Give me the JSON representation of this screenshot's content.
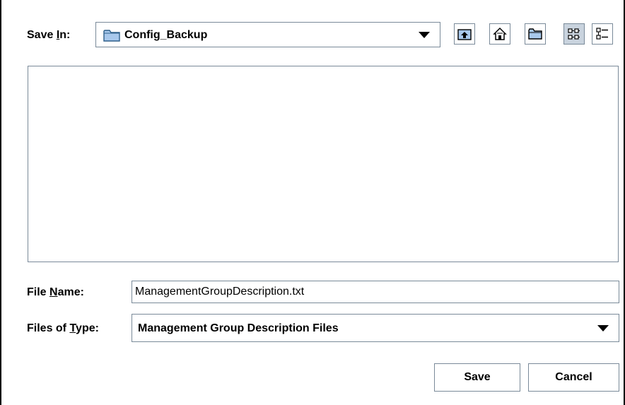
{
  "save_in": {
    "label_pre": "Save ",
    "label_mnemonic": "I",
    "label_post": "n:",
    "folder": "Config_Backup",
    "folder_icon": "folder-icon"
  },
  "toolbar": {
    "up_icon": "up-folder-icon",
    "home_icon": "home-icon",
    "new_folder_icon": "new-folder-icon",
    "list_view_icon": "list-view-icon",
    "details_view_icon": "details-view-icon"
  },
  "file_name": {
    "label_pre": "File ",
    "label_mnemonic": "N",
    "label_post": "ame:",
    "value": "ManagementGroupDescription.txt"
  },
  "file_type": {
    "label_pre": "Files of ",
    "label_mnemonic": "T",
    "label_post": "ype:",
    "value": "Management Group Description Files"
  },
  "buttons": {
    "save": "Save",
    "cancel": "Cancel"
  },
  "colors": {
    "border": "#7a8a99",
    "folder_fill": "#a8c8ec",
    "active_button": "#c9d3de"
  }
}
